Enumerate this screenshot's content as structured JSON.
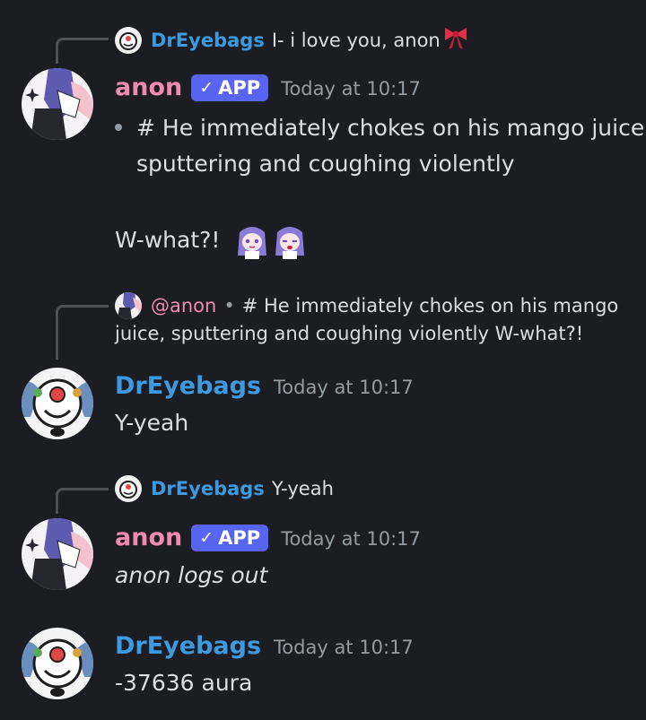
{
  "messages": [
    {
      "reply": {
        "author": "DrEyebags",
        "text": "I- i love you, anon",
        "emoji": "ribbon-emoji"
      },
      "author": "anon",
      "badge": "APP",
      "timestamp": "Today at 10:17",
      "lines": [
        "# He immediately chokes on his mango juice,",
        "sputtering and coughing violently"
      ],
      "extra": "W-what?!",
      "emojis": [
        "anime-girl-emoji",
        "anime-girl-emoji"
      ]
    },
    {
      "reply": {
        "author": "@anon",
        "separator": "•",
        "line1": "# He immediately chokes on his mango",
        "line2": "juice, sputtering and coughing violently     W-what?!"
      },
      "author": "DrEyebags",
      "timestamp": "Today at 10:17",
      "text": "Y-yeah"
    },
    {
      "reply": {
        "author": "DrEyebags",
        "text": "Y-yeah"
      },
      "author": "anon",
      "badge": "APP",
      "timestamp": "Today at 10:17",
      "text": "anon logs out"
    },
    {
      "author": "DrEyebags",
      "timestamp": "Today at 10:17",
      "text": "-37636 aura"
    }
  ],
  "colors": {
    "background": "#1c1d22",
    "anon": "#ee8ab3",
    "dreyebags": "#3d9ae0",
    "badge": "#5865f2",
    "timestamp": "#949ba4"
  }
}
